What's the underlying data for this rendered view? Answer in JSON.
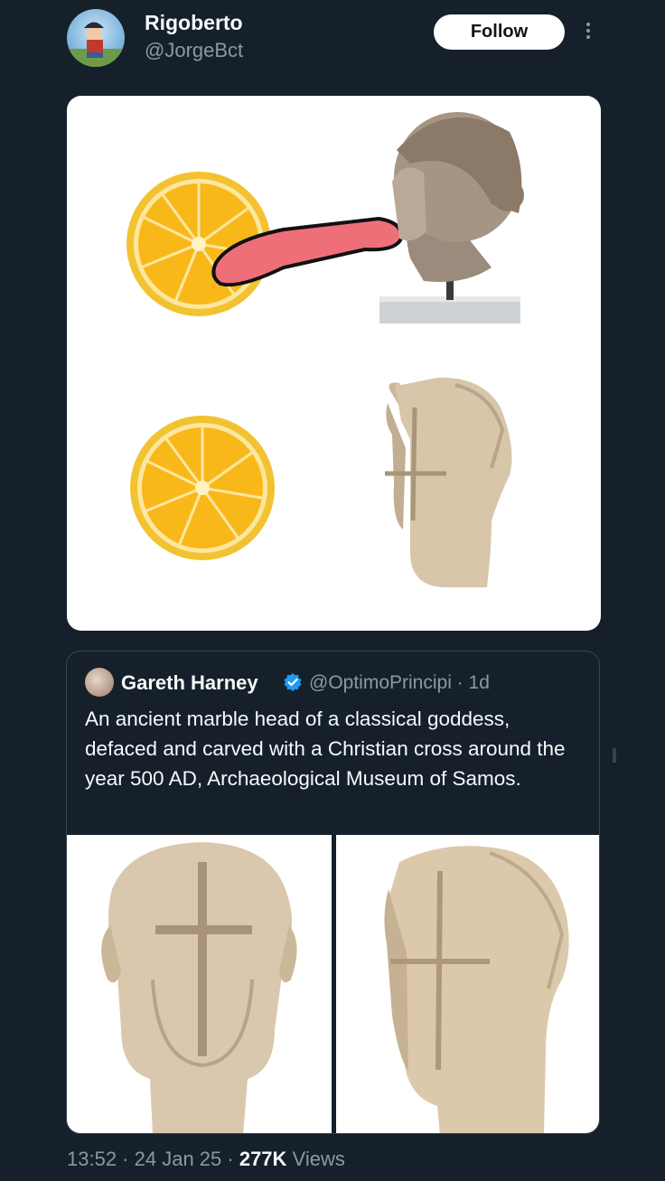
{
  "author": {
    "display_name": "Rigoberto",
    "handle": "@JorgeBct"
  },
  "follow_label": "Follow",
  "quoted": {
    "name": "Gareth Harney",
    "handle": "@OptimoPrincipi",
    "time": "1d",
    "text": "An ancient marble head of a classical goddess, defaced and carved with a Christian cross around the year 500 AD, Archaeological Museum of Samos."
  },
  "footer": {
    "time": "13:52",
    "date": "24 Jan 25",
    "views_count": "277K",
    "views_label": "Views"
  },
  "colors": {
    "background": "#15202b",
    "border": "#38444d",
    "secondary_text": "#8b98a5",
    "verified": "#1d9bf0"
  }
}
